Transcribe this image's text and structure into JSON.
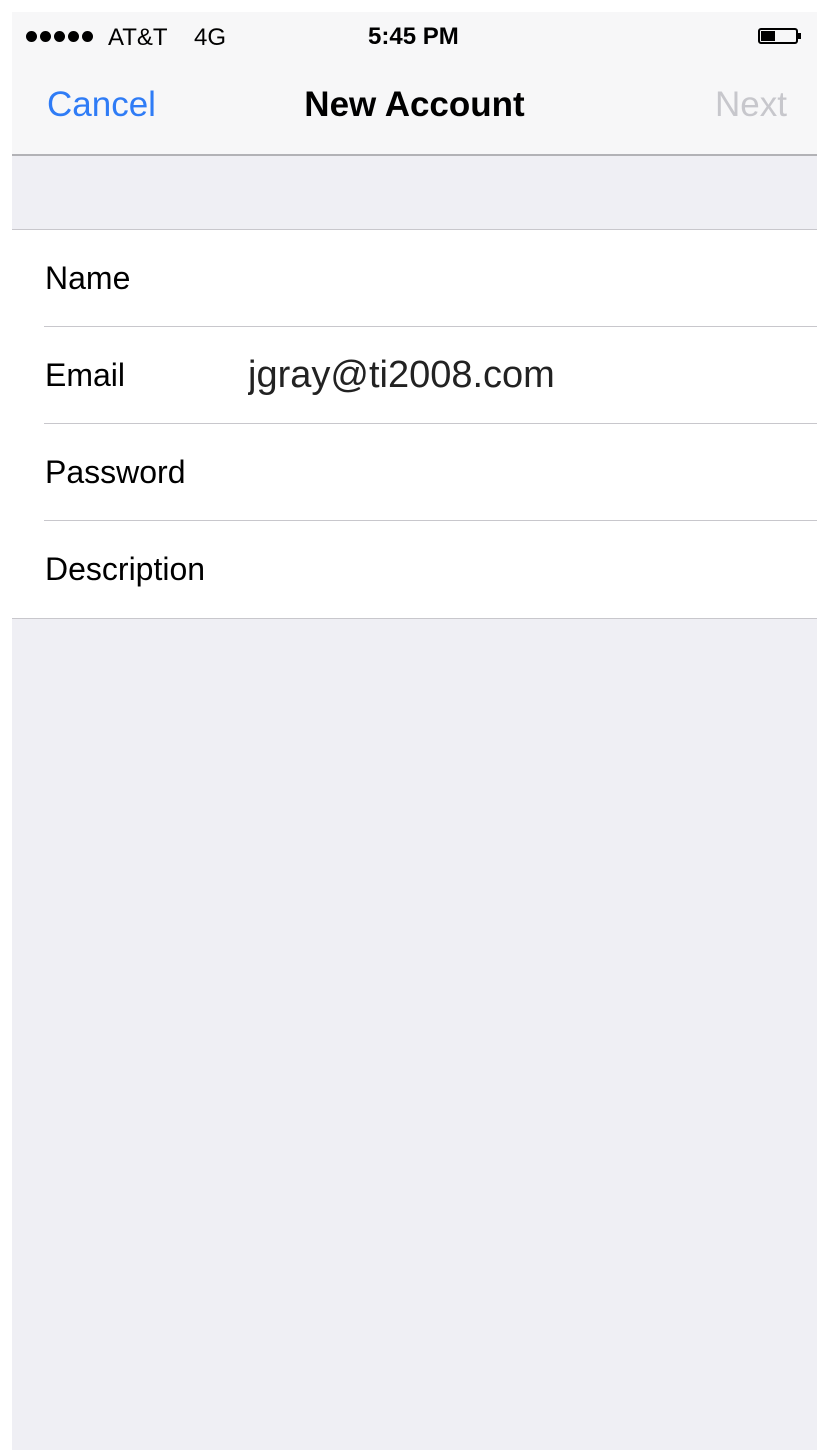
{
  "status_bar": {
    "signal_bars": 5,
    "carrier": "AT&T",
    "network": "4G",
    "time": "5:45 PM",
    "battery_level": 0.4
  },
  "nav": {
    "cancel_label": "Cancel",
    "title": "New Account",
    "next_label": "Next"
  },
  "form": {
    "fields": [
      {
        "label": "Name",
        "value": ""
      },
      {
        "label": "Email",
        "value": "jgray@ti2008.com"
      },
      {
        "label": "Password",
        "value": ""
      },
      {
        "label": "Description",
        "value": ""
      }
    ]
  },
  "colors": {
    "accent": "#2f7cf6",
    "disabled": "#c7c7cc",
    "background": "#efeff4"
  }
}
